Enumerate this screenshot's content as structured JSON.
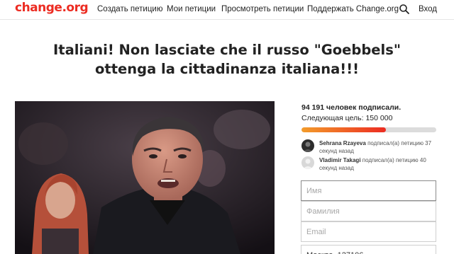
{
  "nav": {
    "logo": "change.org",
    "items": [
      "Создать петицию",
      "Мои петиции",
      "Просмотреть петиции",
      "Поддержать Change.org"
    ],
    "login": "Вход"
  },
  "petition": {
    "title": "Italiani! Non lasciate che il russo \"Goebbels\" ottenga la cittadinanza italiana!!!"
  },
  "sign_box": {
    "signed_text": "94 191 человек подписали.",
    "goal_text": "Следующая цель: 150 000",
    "progress": 0.628,
    "recent_signers": [
      {
        "name": "Sehrana Rzayeva",
        "action": "подписал(а) петицию 37 секунд назад"
      },
      {
        "name": "Vladimir Takagi",
        "action": "подписал(а) петицию 40 секунд назад"
      }
    ],
    "fields": {
      "first_name_placeholder": "Имя",
      "last_name_placeholder": "Фамилия",
      "email_placeholder": "Email",
      "partial_field_value": "Москва, 127106"
    }
  },
  "colors": {
    "brand": "#ec2c22",
    "progress_start": "#f39c2b",
    "progress_end": "#ec2c22",
    "track": "#dcdcdc"
  }
}
